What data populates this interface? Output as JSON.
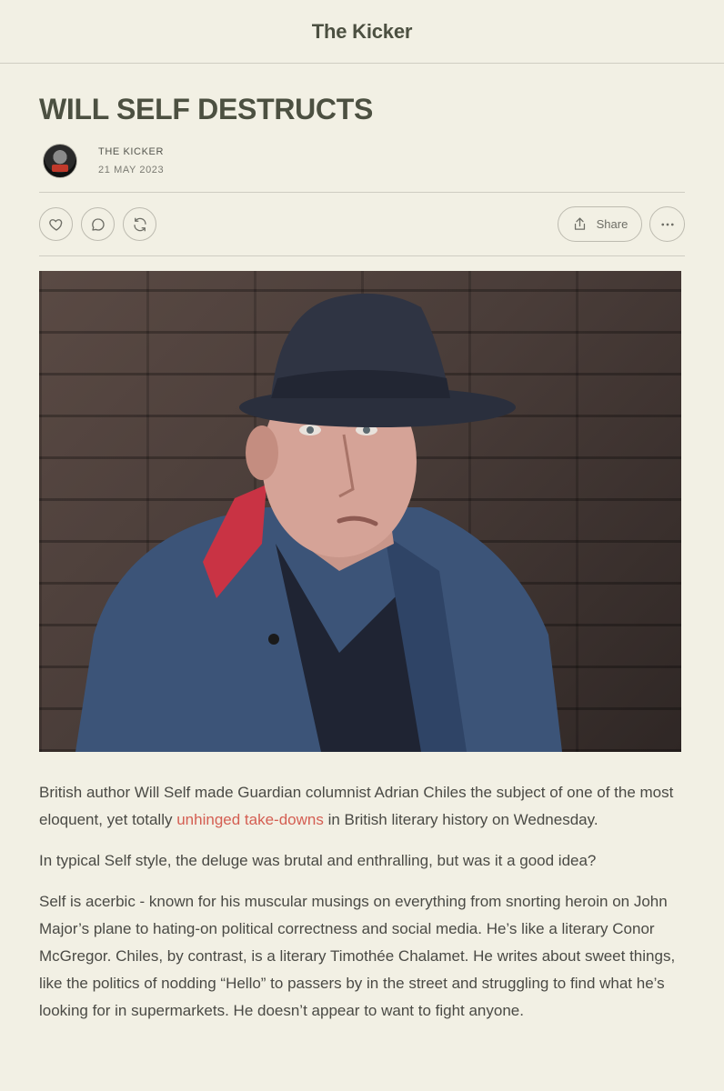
{
  "header": {
    "publication": "The Kicker"
  },
  "article": {
    "title": "WILL SELF DESTRUCTS",
    "author": "THE KICKER",
    "date": "21 MAY 2023",
    "avatar_text": "THE KICKER"
  },
  "actions": {
    "like_icon": "heart-icon",
    "comment_icon": "comment-icon",
    "restack_icon": "restack-icon",
    "share_label": "Share",
    "more_icon": "more-icon"
  },
  "image": {
    "description": "hero-photo"
  },
  "paragraphs": {
    "p1_before": "British author Will Self made Guardian columnist Adrian Chiles the subject of one of the most eloquent, yet totally ",
    "p1_link": "unhinged take-downs",
    "p1_after": " in British literary history on Wednesday.",
    "p2": "In typical Self style, the deluge was brutal and enthralling, but was it a good idea?",
    "p3": "Self is acerbic -  known for his muscular musings on everything from snorting heroin on John Major’s plane to hating-on political correctness and social media. He’s like a literary Conor McGregor. Chiles, by contrast, is a literary Timothée Chalamet. He writes about sweet things, like the politics of nodding “Hello” to passers by in the street and struggling to find what he’s looking for in supermarkets. He doesn’t appear to want to fight anyone."
  },
  "colors": {
    "background": "#f2f0e4",
    "link": "#d45e52",
    "title": "#4c5041"
  }
}
